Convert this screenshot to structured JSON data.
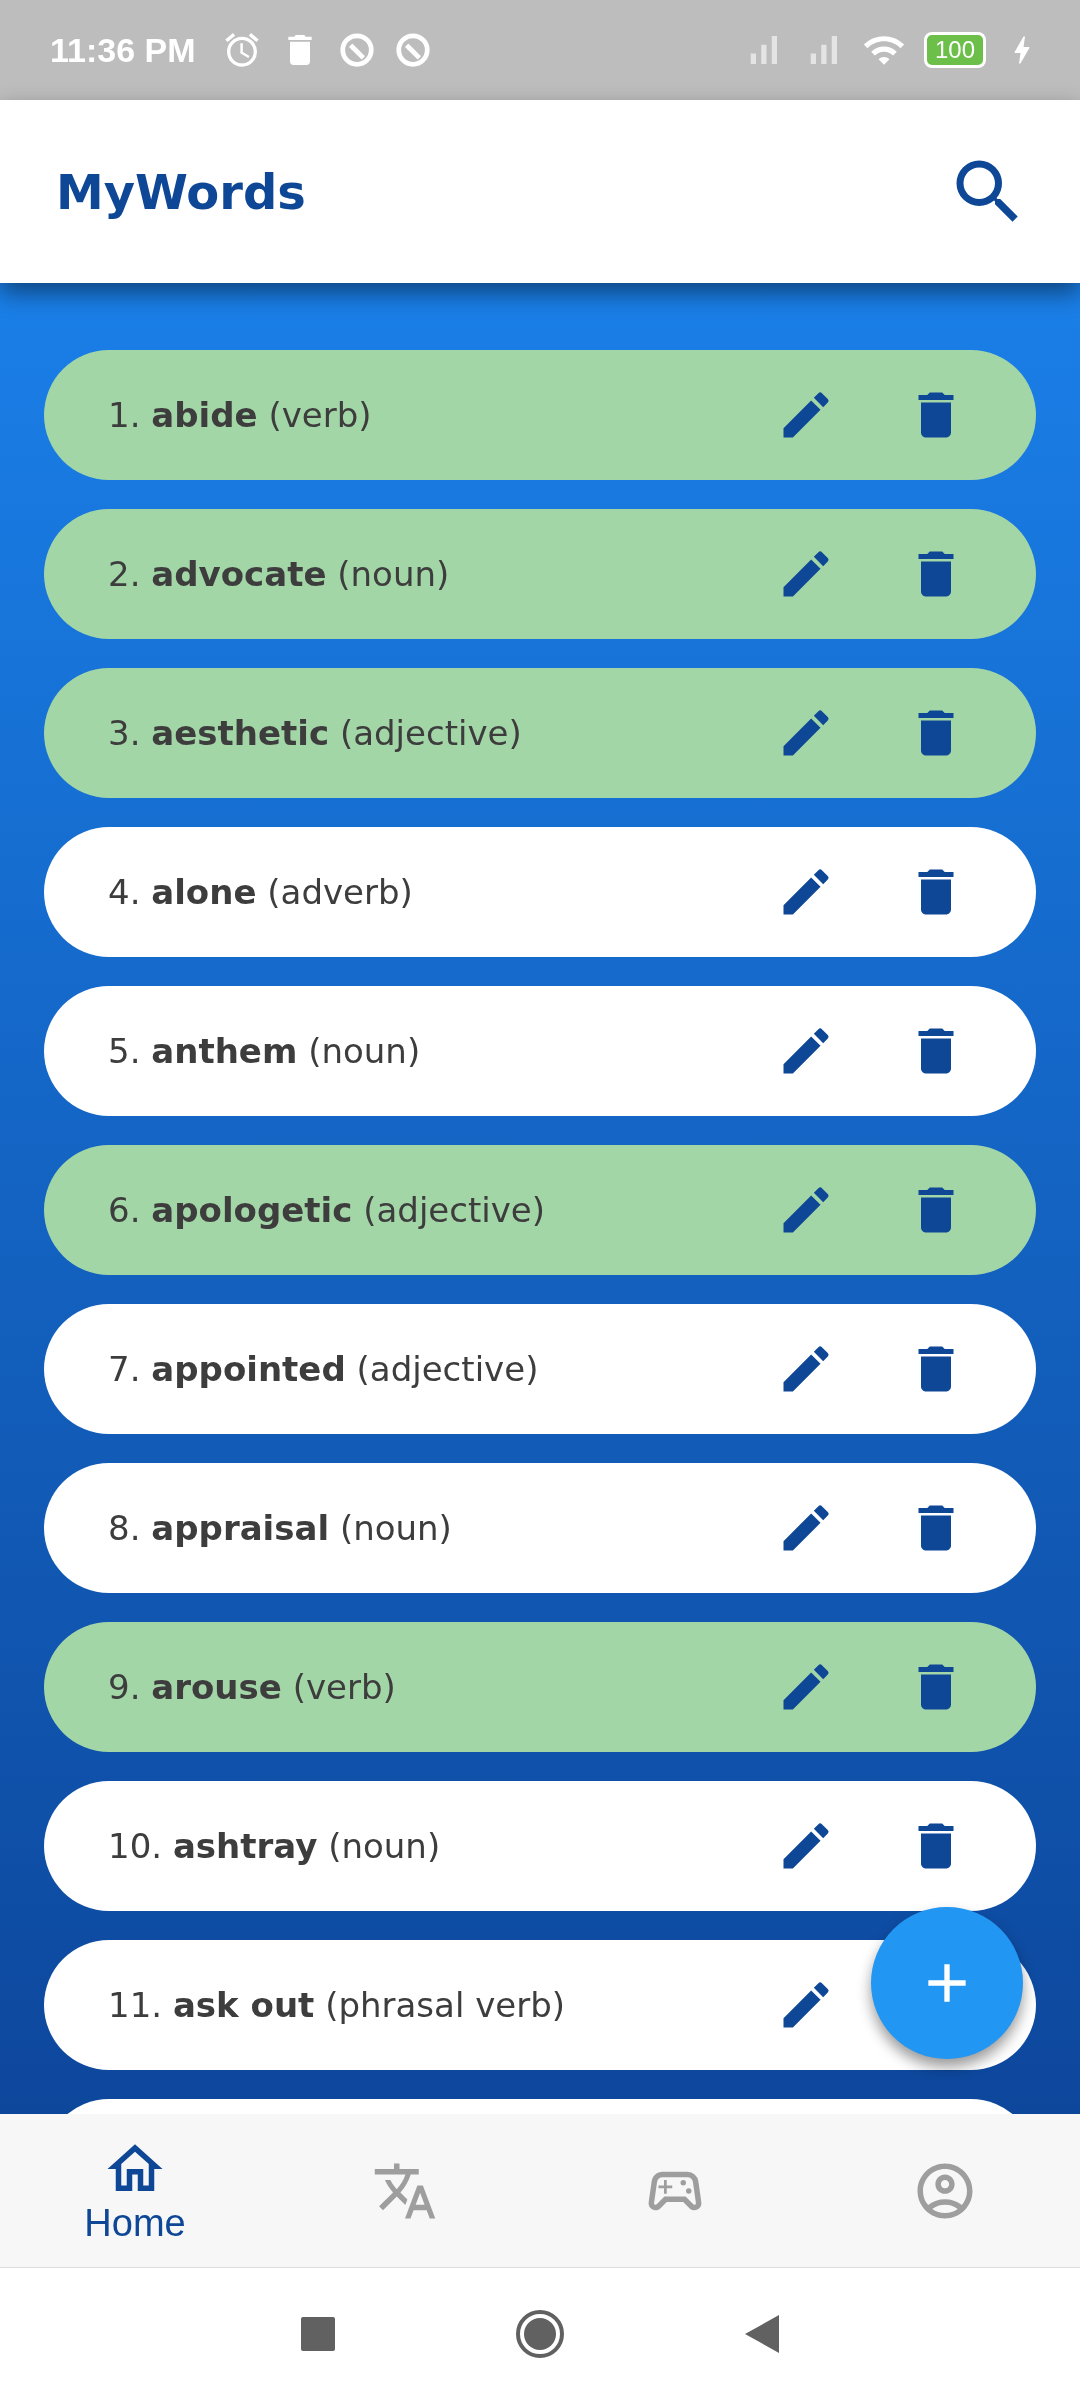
{
  "status_bar": {
    "time": "11:36 PM",
    "battery": "100"
  },
  "app_bar": {
    "title": "MyWords"
  },
  "words": [
    {
      "number": "1.",
      "word": "abide",
      "type": "(verb)",
      "highlighted": true
    },
    {
      "number": "2.",
      "word": "advocate",
      "type": "(noun)",
      "highlighted": true
    },
    {
      "number": "3.",
      "word": "aesthetic",
      "type": "(adjective)",
      "highlighted": true
    },
    {
      "number": "4.",
      "word": "alone",
      "type": "(adverb)",
      "highlighted": false
    },
    {
      "number": "5.",
      "word": "anthem",
      "type": "(noun)",
      "highlighted": false
    },
    {
      "number": "6.",
      "word": "apologetic",
      "type": "(adjective)",
      "highlighted": true
    },
    {
      "number": "7.",
      "word": "appointed",
      "type": "(adjective)",
      "highlighted": false
    },
    {
      "number": "8.",
      "word": "appraisal",
      "type": "(noun)",
      "highlighted": false
    },
    {
      "number": "9.",
      "word": "arouse",
      "type": "(verb)",
      "highlighted": true
    },
    {
      "number": "10.",
      "word": "ashtray",
      "type": "(noun)",
      "highlighted": false
    },
    {
      "number": "11.",
      "word": "ask out",
      "type": "(phrasal verb)",
      "highlighted": false
    }
  ],
  "bottom_nav": [
    {
      "label": "Home",
      "selected": true
    },
    {
      "selected": false
    },
    {
      "selected": false
    },
    {
      "selected": false
    }
  ]
}
